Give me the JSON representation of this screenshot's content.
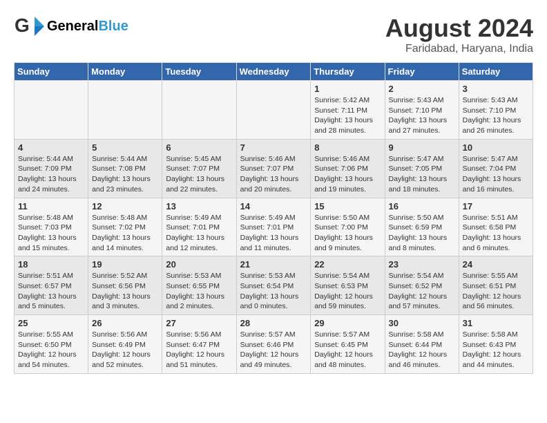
{
  "header": {
    "logo_general": "General",
    "logo_blue": "Blue",
    "month": "August 2024",
    "location": "Faridabad, Haryana, India"
  },
  "columns": [
    "Sunday",
    "Monday",
    "Tuesday",
    "Wednesday",
    "Thursday",
    "Friday",
    "Saturday"
  ],
  "weeks": [
    {
      "days": [
        {
          "num": "",
          "info": ""
        },
        {
          "num": "",
          "info": ""
        },
        {
          "num": "",
          "info": ""
        },
        {
          "num": "",
          "info": ""
        },
        {
          "num": "1",
          "info": "Sunrise: 5:42 AM\nSunset: 7:11 PM\nDaylight: 13 hours\nand 28 minutes."
        },
        {
          "num": "2",
          "info": "Sunrise: 5:43 AM\nSunset: 7:10 PM\nDaylight: 13 hours\nand 27 minutes."
        },
        {
          "num": "3",
          "info": "Sunrise: 5:43 AM\nSunset: 7:10 PM\nDaylight: 13 hours\nand 26 minutes."
        }
      ]
    },
    {
      "days": [
        {
          "num": "4",
          "info": "Sunrise: 5:44 AM\nSunset: 7:09 PM\nDaylight: 13 hours\nand 24 minutes."
        },
        {
          "num": "5",
          "info": "Sunrise: 5:44 AM\nSunset: 7:08 PM\nDaylight: 13 hours\nand 23 minutes."
        },
        {
          "num": "6",
          "info": "Sunrise: 5:45 AM\nSunset: 7:07 PM\nDaylight: 13 hours\nand 22 minutes."
        },
        {
          "num": "7",
          "info": "Sunrise: 5:46 AM\nSunset: 7:07 PM\nDaylight: 13 hours\nand 20 minutes."
        },
        {
          "num": "8",
          "info": "Sunrise: 5:46 AM\nSunset: 7:06 PM\nDaylight: 13 hours\nand 19 minutes."
        },
        {
          "num": "9",
          "info": "Sunrise: 5:47 AM\nSunset: 7:05 PM\nDaylight: 13 hours\nand 18 minutes."
        },
        {
          "num": "10",
          "info": "Sunrise: 5:47 AM\nSunset: 7:04 PM\nDaylight: 13 hours\nand 16 minutes."
        }
      ]
    },
    {
      "days": [
        {
          "num": "11",
          "info": "Sunrise: 5:48 AM\nSunset: 7:03 PM\nDaylight: 13 hours\nand 15 minutes."
        },
        {
          "num": "12",
          "info": "Sunrise: 5:48 AM\nSunset: 7:02 PM\nDaylight: 13 hours\nand 14 minutes."
        },
        {
          "num": "13",
          "info": "Sunrise: 5:49 AM\nSunset: 7:01 PM\nDaylight: 13 hours\nand 12 minutes."
        },
        {
          "num": "14",
          "info": "Sunrise: 5:49 AM\nSunset: 7:01 PM\nDaylight: 13 hours\nand 11 minutes."
        },
        {
          "num": "15",
          "info": "Sunrise: 5:50 AM\nSunset: 7:00 PM\nDaylight: 13 hours\nand 9 minutes."
        },
        {
          "num": "16",
          "info": "Sunrise: 5:50 AM\nSunset: 6:59 PM\nDaylight: 13 hours\nand 8 minutes."
        },
        {
          "num": "17",
          "info": "Sunrise: 5:51 AM\nSunset: 6:58 PM\nDaylight: 13 hours\nand 6 minutes."
        }
      ]
    },
    {
      "days": [
        {
          "num": "18",
          "info": "Sunrise: 5:51 AM\nSunset: 6:57 PM\nDaylight: 13 hours\nand 5 minutes."
        },
        {
          "num": "19",
          "info": "Sunrise: 5:52 AM\nSunset: 6:56 PM\nDaylight: 13 hours\nand 3 minutes."
        },
        {
          "num": "20",
          "info": "Sunrise: 5:53 AM\nSunset: 6:55 PM\nDaylight: 13 hours\nand 2 minutes."
        },
        {
          "num": "21",
          "info": "Sunrise: 5:53 AM\nSunset: 6:54 PM\nDaylight: 13 hours\nand 0 minutes."
        },
        {
          "num": "22",
          "info": "Sunrise: 5:54 AM\nSunset: 6:53 PM\nDaylight: 12 hours\nand 59 minutes."
        },
        {
          "num": "23",
          "info": "Sunrise: 5:54 AM\nSunset: 6:52 PM\nDaylight: 12 hours\nand 57 minutes."
        },
        {
          "num": "24",
          "info": "Sunrise: 5:55 AM\nSunset: 6:51 PM\nDaylight: 12 hours\nand 56 minutes."
        }
      ]
    },
    {
      "days": [
        {
          "num": "25",
          "info": "Sunrise: 5:55 AM\nSunset: 6:50 PM\nDaylight: 12 hours\nand 54 minutes."
        },
        {
          "num": "26",
          "info": "Sunrise: 5:56 AM\nSunset: 6:49 PM\nDaylight: 12 hours\nand 52 minutes."
        },
        {
          "num": "27",
          "info": "Sunrise: 5:56 AM\nSunset: 6:47 PM\nDaylight: 12 hours\nand 51 minutes."
        },
        {
          "num": "28",
          "info": "Sunrise: 5:57 AM\nSunset: 6:46 PM\nDaylight: 12 hours\nand 49 minutes."
        },
        {
          "num": "29",
          "info": "Sunrise: 5:57 AM\nSunset: 6:45 PM\nDaylight: 12 hours\nand 48 minutes."
        },
        {
          "num": "30",
          "info": "Sunrise: 5:58 AM\nSunset: 6:44 PM\nDaylight: 12 hours\nand 46 minutes."
        },
        {
          "num": "31",
          "info": "Sunrise: 5:58 AM\nSunset: 6:43 PM\nDaylight: 12 hours\nand 44 minutes."
        }
      ]
    }
  ]
}
